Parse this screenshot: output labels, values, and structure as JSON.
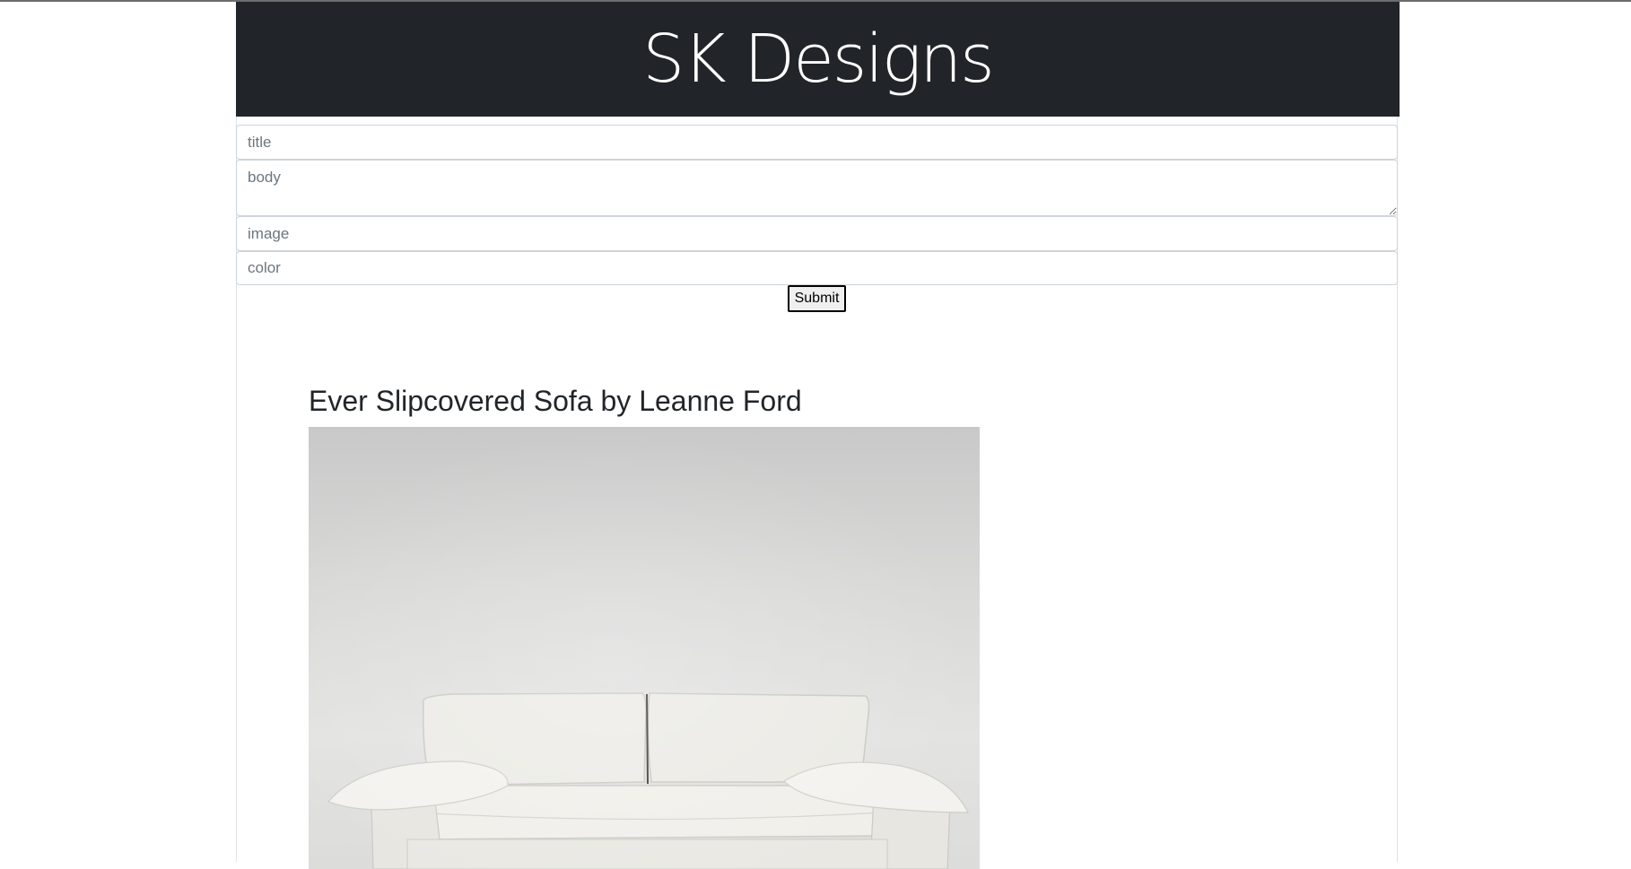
{
  "header": {
    "title": "SK Designs"
  },
  "form": {
    "title_placeholder": "title",
    "body_placeholder": "body",
    "image_placeholder": "image",
    "color_placeholder": "color",
    "submit_label": "Submit"
  },
  "posts": [
    {
      "title": "Ever Slipcovered Sofa by Leanne Ford",
      "image_alt": "sofa"
    }
  ],
  "colors": {
    "header_bg": "#212529",
    "header_text": "#ffffff",
    "border": "#ced4da"
  }
}
